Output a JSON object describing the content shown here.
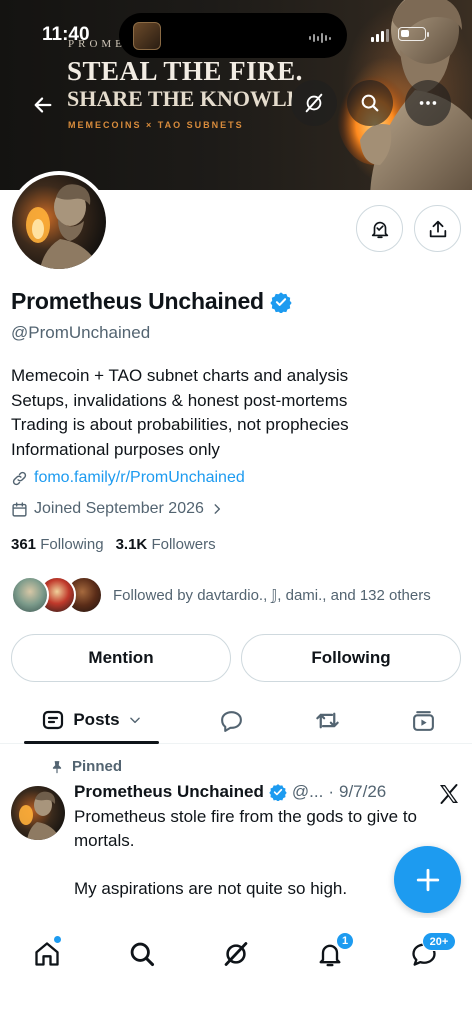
{
  "status_bar": {
    "time": "11:40"
  },
  "banner": {
    "brand": "PROMETHEUS",
    "headline_line1": "STEAL THE FIRE.",
    "headline_line2": "SHARE THE KNOWLEDGE",
    "subtitle": "MEMECOINS × TAO SUBNETS"
  },
  "profile": {
    "display_name": "Prometheus Unchained",
    "handle": "@PromUnchained",
    "verified": true,
    "bio": [
      "Memecoin + TAO subnet charts and analysis",
      "Setups, invalidations & honest post-mortems",
      "Trading is about probabilities, not prophecies",
      "Informational purposes only"
    ],
    "link": "fomo.family/r/PromUnchained",
    "joined": "Joined September 2026",
    "following_count": "361",
    "following_label": "Following",
    "followers_count": "3.1K",
    "followers_label": "Followers",
    "followed_by": "Followed by davtardio., 𝕁, dami., and 132 others"
  },
  "actions": {
    "mention_label": "Mention",
    "following_label": "Following"
  },
  "tabs": {
    "posts_label": "Posts"
  },
  "pinned_post": {
    "pinned_label": "Pinned",
    "author": "Prometheus Unchained",
    "handle_short": "@...",
    "separator": "·",
    "date": "9/7/26",
    "text_line1": "Prometheus stole fire from the gods to give to mortals.",
    "text_line2": "My aspirations are not quite so high."
  },
  "bottom_nav": {
    "notifications_badge": "1",
    "messages_badge": "20+"
  },
  "colors": {
    "accent": "#1d9bf0",
    "text_primary": "#0f1419",
    "text_secondary": "#536471",
    "border": "#cfd9de"
  },
  "icons": [
    "back-arrow-icon",
    "grok-icon",
    "search-icon",
    "more-icon",
    "notification-bell-icon",
    "share-icon",
    "verified-badge-icon",
    "link-icon",
    "calendar-icon",
    "chevron-right-icon",
    "posts-tab-icon",
    "chevron-down-icon",
    "replies-tab-icon",
    "reposts-tab-icon",
    "media-tab-icon",
    "pin-icon",
    "x-logo-icon",
    "plus-icon",
    "home-icon",
    "search-nav-icon",
    "grok-nav-icon",
    "notifications-nav-icon",
    "messages-nav-icon"
  ]
}
